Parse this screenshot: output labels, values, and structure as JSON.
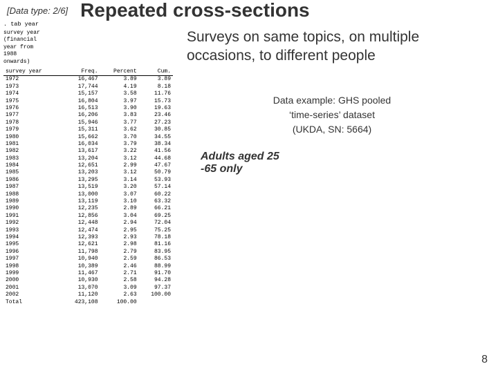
{
  "header": {
    "data_type_label": "[Data type: 2/6]",
    "main_title": "Repeated cross-sections"
  },
  "subtitle": "Surveys on same topics, on multiple occasions, to different people",
  "stata": {
    "command": ". tab year",
    "var_desc": "survey year\n(financial\nyear from\n1988\nonwards)",
    "columns": [
      "Freq.",
      "Percent",
      "Cum."
    ],
    "rows": [
      [
        "1972",
        "16,467",
        "3.89",
        "3.89"
      ],
      [
        "1973",
        "17,744",
        "4.19",
        "8.18"
      ],
      [
        "1974",
        "15,157",
        "3.58",
        "11.76"
      ],
      [
        "1975",
        "16,804",
        "3.97",
        "15.73"
      ],
      [
        "1976",
        "16,513",
        "3.90",
        "19.63"
      ],
      [
        "1977",
        "16,206",
        "3.83",
        "23.46"
      ],
      [
        "1978",
        "15,946",
        "3.77",
        "27.23"
      ],
      [
        "1979",
        "15,311",
        "3.62",
        "30.85"
      ],
      [
        "1980",
        "15,662",
        "3.70",
        "34.55"
      ],
      [
        "1981",
        "16,034",
        "3.79",
        "38.34"
      ],
      [
        "1982",
        "13,617",
        "3.22",
        "41.56"
      ],
      [
        "1983",
        "13,204",
        "3.12",
        "44.68"
      ],
      [
        "1984",
        "12,651",
        "2.99",
        "47.67"
      ],
      [
        "1985",
        "13,203",
        "3.12",
        "50.79"
      ],
      [
        "1986",
        "13,295",
        "3.14",
        "53.93"
      ],
      [
        "1987",
        "13,519",
        "3.20",
        "57.14"
      ],
      [
        "1988",
        "13,000",
        "3.07",
        "60.22"
      ],
      [
        "1989",
        "13,119",
        "3.10",
        "63.32"
      ],
      [
        "1990",
        "12,235",
        "2.89",
        "66.21"
      ],
      [
        "1991",
        "12,856",
        "3.04",
        "69.25"
      ],
      [
        "1992",
        "12,448",
        "2.94",
        "72.04"
      ],
      [
        "1993",
        "12,474",
        "2.95",
        "75.25"
      ],
      [
        "1994",
        "12,393",
        "2.93",
        "78.18"
      ],
      [
        "1995",
        "12,621",
        "2.98",
        "81.16"
      ],
      [
        "1996",
        "11,798",
        "2.79",
        "83.95"
      ],
      [
        "1997",
        "10,940",
        "2.59",
        "86.53"
      ],
      [
        "1998",
        "10,389",
        "2.46",
        "88.99"
      ],
      [
        "1999",
        "11,467",
        "2.71",
        "91.70"
      ],
      [
        "2000",
        "10,930",
        "2.58",
        "94.28"
      ],
      [
        "2001",
        "13,070",
        "3.09",
        "97.37"
      ],
      [
        "2002",
        "11,120",
        "2.63",
        "100.00"
      ]
    ],
    "total": [
      "Total",
      "423,108",
      "100.00",
      ""
    ]
  },
  "data_example": {
    "text": "Data example: GHS pooled\n‘time-series’ dataset\n(UKDA, SN: 5664)"
  },
  "adults_text": "Adults aged 25\n-65 only",
  "page_number": "8"
}
